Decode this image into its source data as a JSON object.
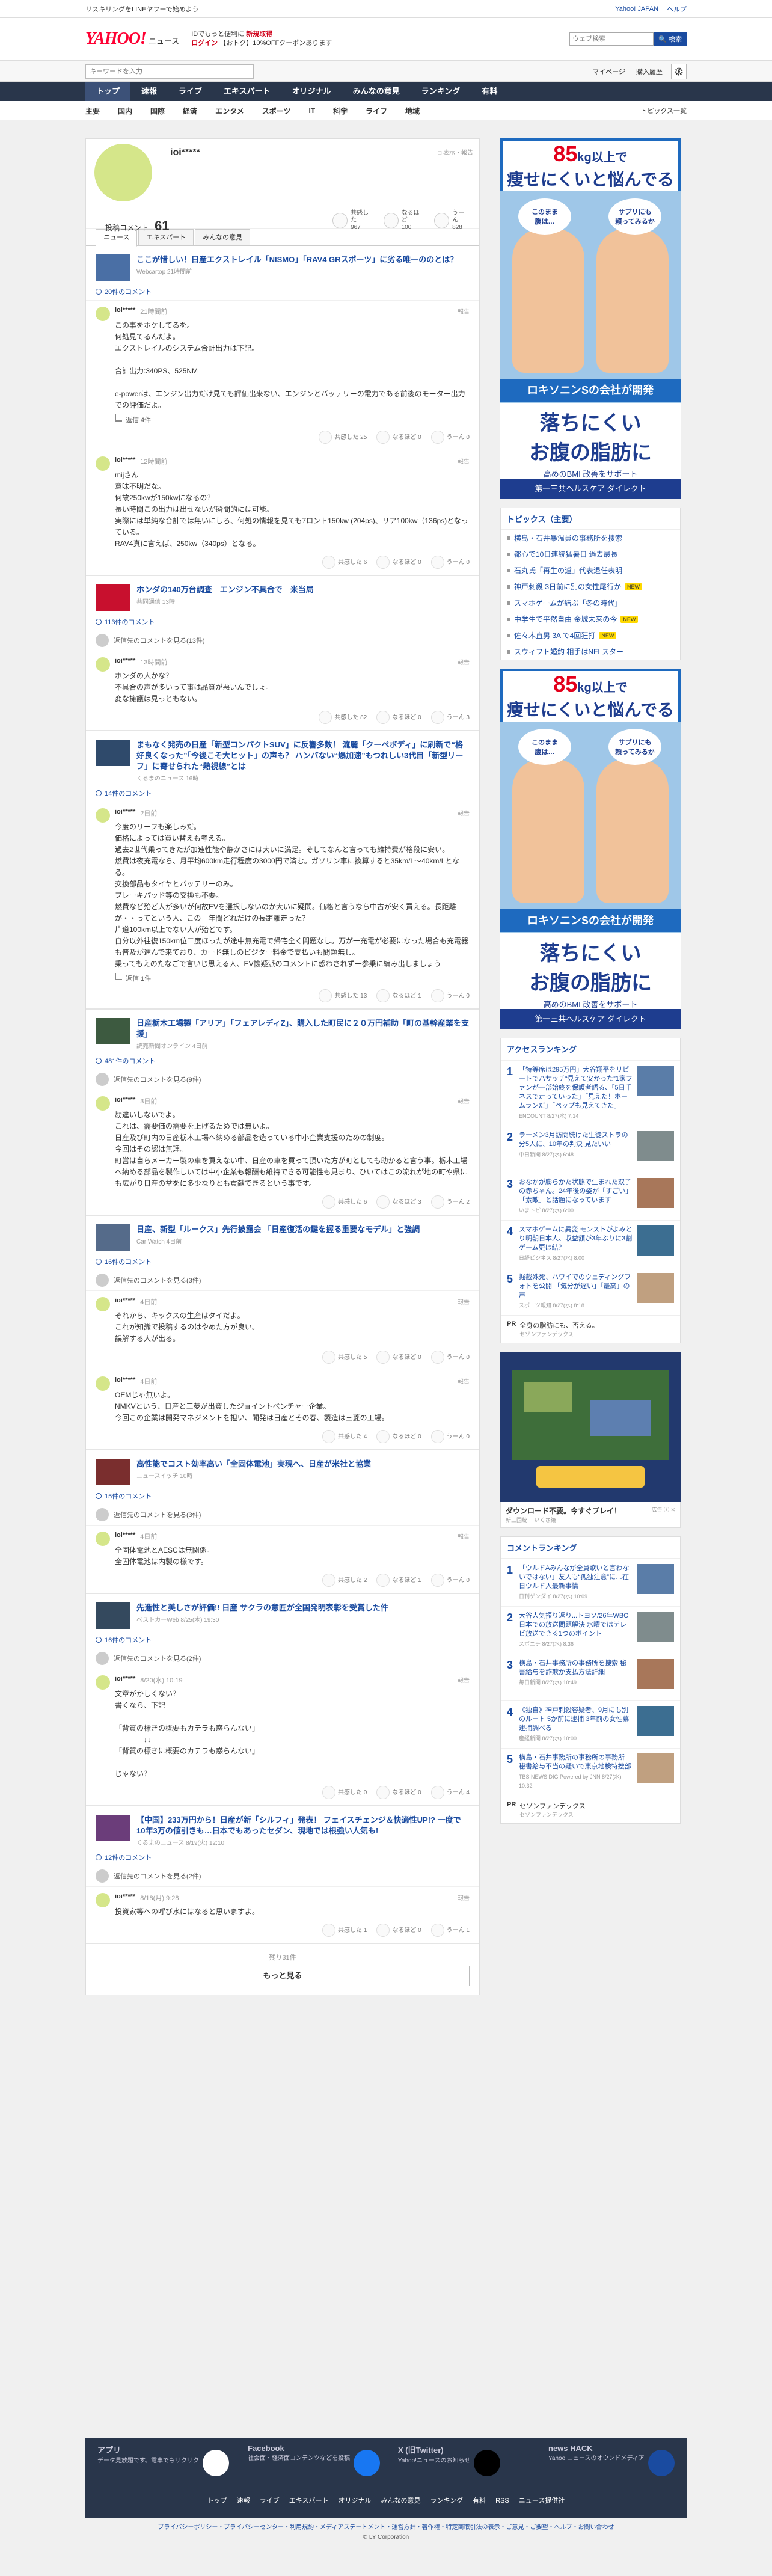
{
  "toplinks": {
    "left": "リスキリングをLINEヤフーで始めよう",
    "right": [
      "Yahoo! JAPAN",
      "ヘルプ"
    ]
  },
  "header": {
    "logo": "YAHOO!",
    "logo_sub": "ニュース",
    "promo_line1": "IDでもっと便利に",
    "promo_new": "新規取得",
    "promo_line2_a": "ログイン",
    "promo_line2_b": "【おトク】10%OFFクーポンあります",
    "search_placeholder": "ウェブ検索",
    "search_button": "🔍 検索"
  },
  "subbar": {
    "placeholder": "キーワードを入力",
    "mypage": "マイページ",
    "purchase": "購入履歴"
  },
  "nav": [
    "トップ",
    "速報",
    "ライブ",
    "エキスパート",
    "オリジナル",
    "みんなの意見",
    "ランキング",
    "有料"
  ],
  "cats": [
    "主要",
    "国内",
    "国際",
    "経済",
    "エンタメ",
    "スポーツ",
    "IT",
    "科学",
    "ライフ",
    "地域"
  ],
  "cat_list": "トピックス一覧",
  "profile": {
    "name": "ioi*****",
    "note": "□ 表示・報告",
    "count_label": "投稿コメント",
    "count": "61",
    "stats": [
      {
        "l1": "共感した",
        "l2": "967"
      },
      {
        "l1": "なるほど",
        "l2": "100"
      },
      {
        "l1": "うーん",
        "l2": "828"
      }
    ]
  },
  "tabs": [
    "ニュース",
    "エキスパート",
    "みんなの意見"
  ],
  "sections": [
    {
      "title": "ここが惜しい！日産エクストレイル「NISMO」「RAV4 GRスポーツ」に劣る唯一ののとは？",
      "src": "Webcartop 21時間前",
      "more": "20件のコメント",
      "comments": [
        {
          "name": "ioi*****",
          "time": "21時間前",
          "body": "この事をホケしてるを。\n何処見てるんだよ。\nエクストレイルのシステム合計出力は下記。\n\n合計出力:340PS、525NM\n\ne-powerは、エンジン出力だけ見ても評価出来ない、エンジンとバッテリーの電力である前後のモーター出力での評価だよ。",
          "reply": "返信 4件",
          "r": [
            "共感した 25",
            "なるほど 0",
            "うーん 0"
          ]
        },
        {
          "name": "ioi*****",
          "time": "12時間前",
          "body": "mijさん\n意味不明だな。\n何故250kwが150kwになるの？\n長い時間この出力は出せないが瞬間的には可能。\n実際には単純な合計では無いにしろ、何処の情報を見ても7ロント150kw (204ps)、リア100kw（136ps)となっている。\nRAV4真に言えば、250kw（340ps）となる。",
          "reply": "",
          "r": [
            "共感した 6",
            "なるほど 0",
            "うーん 0"
          ]
        }
      ]
    },
    {
      "title": "ホンダの140万台調査　エンジン不具合で　米当局",
      "src": "共同通信 13時",
      "more": "113件のコメント",
      "collapsed": "返信先のコメントを見る(13件)",
      "comments": [
        {
          "name": "ioi*****",
          "time": "13時間前",
          "body": "ホンダの人かな？\n不具合の声が多いって事は品質が悪いんでしょ。\n変な擁護は見っともない。",
          "reply": "",
          "r": [
            "共感した 82",
            "なるほど 0",
            "うーん 3"
          ]
        }
      ]
    },
    {
      "title": "まもなく発売の日産「新型コンパクトSUV」に反響多数！ 流麗「クーペボディ」に刷新で“格好良くなった”「今後こそ大ヒット」の声も？ ハンパない“爆加速”もつれしい3代目「新型リーフ」に寄せられた“熱視線”とは",
      "src": "くるまのニュース 16時",
      "more": "14件のコメント",
      "comments": [
        {
          "name": "ioi*****",
          "time": "2日前",
          "body": "今度のリーフも楽しみだ。\n価格によっては買い替えも考える。\n過去2世代乗ってきたが加速性能や静かさには大いに満足。そしてなんと言っても維持費が格段に安い。\n燃費は夜充電なら、月平均600km走行程度の3000円で済む。ガソリン車に換算すると35km/L〜40km/Lとなる。\n交換部品もタイヤとバッテリーのみ。\nブレーキパッド等の交換も不要。\n燃費など殆ど人が多いが何故EVを選択しないのか大いに疑問。価格と言うなら中古が安く買える。長距離が・・ってという人、この一年間どれだけの長距離走った？\n片道100km以上でない人が殆どです。\n自分以外往復150km位二度ほったが途中無充電で帰宅全く問題なし。万が一充電が必要になった場合も充電器も普及が進んで来ており、カード無しのビジター料金で支払いも問題無し。\n乗ってもえのたなごで言いじ思える人、EV懐疑派のコメントに惑わされず一参乗に編み出しましょう",
          "reply": "返信 1件",
          "r": [
            "共感した 13",
            "なるほど 1",
            "うーん 0"
          ]
        }
      ]
    },
    {
      "title": "日産栃木工場製「アリア」「フェアレディZ」、購入した町民に２０万円補助「町の基幹産業を支援」",
      "src": "読売新聞オンライン 4日前",
      "more": "481件のコメント",
      "collapsed": "返信先のコメントを見る(9件)",
      "comments": [
        {
          "name": "ioi*****",
          "time": "3日前",
          "body": "勘違いしないでよ。\nこれは、需要価の需要を上げるためでは無いよ。\n日産及び町内の日産栃木工場へ納める部品を造っている中小企業支援のための制度。\n今回はその認は無理。\n町営は自らメーカー製の車を買えない中、日産の車を買って頂いた方が町としても助かると言う事。栃木工場へ納める部品を製作しいては中小企業も報酬も維持できる可能性も見まり、ひいてはこの流れが地の町や県にも広がり日産の益をに多少なりとも貢献できるという事です。",
          "reply": "",
          "r": [
            "共感した 6",
            "なるほど 3",
            "うーん 2"
          ]
        }
      ]
    },
    {
      "title": "日産、新型「ルークス」先行披露会 「日産復活の鍵を握る重要なモデル」と強調",
      "src": "Car Watch 4日前",
      "more": "16件のコメント",
      "collapsed": "返信先のコメントを見る(3件)",
      "comments": [
        {
          "name": "ioi*****",
          "time": "4日前",
          "body": "それから、キックスの生産はタイだよ。\nこれが知識で投稿するのはやめた方が良い。\n誤解する人が出る。",
          "reply": "",
          "r": [
            "共感した 5",
            "なるほど 0",
            "うーん 0"
          ]
        },
        {
          "name": "ioi*****",
          "time": "4日前",
          "body": "OEMじゃ無いよ。\nNMKVという、日産と三菱が出資したジョイントベンチャー企業。\n今回この企業は開発マネジメントを担い、開発は日産とその春、製造は三菱の工場。",
          "reply": "",
          "r": [
            "共感した 4",
            "なるほど 0",
            "うーん 0"
          ]
        }
      ]
    },
    {
      "title": "高性能でコスト効率高い「全固体電池」実現へ、日産が米社と協業",
      "src": "ニュースイッチ 10時",
      "more": "15件のコメント",
      "collapsed": "返信先のコメントを見る(3件)",
      "comments": [
        {
          "name": "ioi*****",
          "time": "4日前",
          "body": "全固体電池とAESCは無関係。\n全固体電池は内製の様です。",
          "reply": "",
          "r": [
            "共感した 2",
            "なるほど 1",
            "うーん 0"
          ]
        }
      ]
    },
    {
      "title": "先進性と美しさが評価!! 日産 サクラの意匠が全国発明表彰を受賞した件",
      "src": "ベストカーWeb 8/25(木) 19:30",
      "more": "16件のコメント",
      "collapsed": "返信先のコメントを見る(2件)",
      "comments": [
        {
          "name": "ioi*****",
          "time": "8/20(水) 10:19",
          "body": "文章がかしくない？\n書くなら、下記\n\n「背質の標きの概要もカテラも惑らんない」\n　　　　↓↓\n「背質の標きに概要のカテラも惑らんない」\n\nじゃない？",
          "reply": "",
          "r": [
            "共感した 0",
            "なるほど 0",
            "うーん 4"
          ]
        }
      ]
    },
    {
      "title": "【中国】233万円から！日産が新「シルフィ」発表！ フェイスチェンジ＆快適性UP!? 一度で10年3万の値引きも…日本でもあったセダン、現地では根強い人気も!",
      "src": "くるまのニュース 8/19(火) 12:10",
      "more": "12件のコメント",
      "collapsed": "返信先のコメントを見る(2件)",
      "comments": [
        {
          "name": "ioi*****",
          "time": "8/18(月) 9:28",
          "body": "投資家等への呼び水にはなると思いますよ。",
          "reply": "",
          "r": [
            "共感した 1",
            "なるほど 0",
            "うーん 1"
          ]
        }
      ]
    }
  ],
  "list_footer": {
    "count": "残り31件",
    "load_more": "もっと見る"
  },
  "ad": {
    "label": "広告 ⓘ ✕",
    "weight": "85",
    "weight_unit": "kg以上で",
    "line1": "痩せにくいと悩んでる",
    "bubble1": "このまま\n腹は…",
    "bubble2": "サプリにも\n頼ってみるか",
    "band": "ロキソニンSの会社が開発",
    "big1": "落ちにくい",
    "big2": "お腹の脂肪に",
    "sub": "高めのBMI 改善をサポート",
    "foot": "第一三共ヘルスケア ダイレクト"
  },
  "topics": {
    "title": "トピックス（主要）",
    "items": [
      {
        "t": "横島・石井暴温員の事務所を捜索",
        "b": ""
      },
      {
        "t": "都心で10日連続猛暑日 過去最長",
        "b": ""
      },
      {
        "t": "石丸氏「再生の道」代表退任表明",
        "b": ""
      },
      {
        "t": "神戸刺殺 3日前に別の女性尾行か",
        "b": "NEW"
      },
      {
        "t": "スマホゲームが結ぶ「冬の時代」",
        "b": ""
      },
      {
        "t": "中学生で平然自由 金城未来の今",
        "b": "NEW"
      },
      {
        "t": "佐々木直男 3A で4回狂打",
        "b": "NEW"
      },
      {
        "t": "スウィフト婚約 相手はNFLスター",
        "b": ""
      }
    ]
  },
  "access": {
    "title": "アクセスランキング",
    "items": [
      {
        "t": "「特等席は295万円」大谷翔平をリピートでハサッチ“見えて安かった”1家ファンが一部始終を保護者語る、「5日千ネスで走っていった」「見えた！ホームランだ」「ペップも見えてきた」",
        "s": "ENCOUNT 8/27(水) 7:14"
      },
      {
        "t": "ラーメン3月訪問続けた生徒ストラの分5人に、10年の判決 見たいい",
        "s": "中日新聞 8/27(水) 6:48"
      },
      {
        "t": "おなかが膨らかた状態で生まれた双子の赤ちゃん。24年後の姿が「すごい」「素敵」と話題になっています",
        "s": "いまトピ 8/27(水) 6:00"
      },
      {
        "t": "スマホゲームに異変 モンストがよみとり明朝日本人、収益額が3年ぶりに3割ゲーム更は結？",
        "s": "日経ビジネス 8/27(水) 8:00"
      },
      {
        "t": "掘截殊死、ハワイでのウェディングフォトを公開 「気分が遅い」「最高」の声",
        "s": "スポーツ報知 8/27(水) 8:18"
      }
    ]
  },
  "pr1": {
    "label": "PR",
    "t": "全身の脂肪にも、否える。",
    "s": "セゾンファンデックス"
  },
  "game": {
    "title": "ダウンロード不要。今すぐプレイ！",
    "sub": "新三国統一 いくさ絵",
    "label": "広告 ⓘ ✕"
  },
  "comment_rank": {
    "title": "コメントランキング",
    "items": [
      {
        "t": "「ウルドAみんなが全員歌いと言わないではない」友人も“孤独注意”に…在日ウルド人最新事情",
        "s": "日刊ゲンダイ 8/27(水) 10:09"
      },
      {
        "t": "大谷人気振り返り...トヨソ/26年WBC日本での放送問題解決 水曜ではテレビ放送できる1つのポイント",
        "s": "スポニチ 8/27(水) 8:36"
      },
      {
        "t": "横島・石井事務所の事務所を捜索 秘書給与を詐欺か支払方法詳細",
        "s": "毎日新聞 8/27(水) 10:49"
      },
      {
        "t": "《独自》神戸刺殺容疑者、9月にも別のルート 5か前に逮捕 3年前の女性慕逮捕調べる",
        "s": "産経新聞 8/27(水) 10:00"
      },
      {
        "t": "横島・石井事務所の事務所の事務所 秘書給与不当の疑いで東京地検特捜部",
        "s": "TBS NEWS DIG Powered by JNN 8/27(水) 10:32"
      }
    ]
  },
  "pr2": {
    "label": "PR",
    "t": "セゾンファンデックス",
    "s": "セゾンファンデックス"
  },
  "footer": {
    "cols": [
      {
        "t": "アプリ",
        "s": "データ見放題です。電車でもサクサク"
      },
      {
        "t": "Facebook",
        "s": "社会面・経済面コンテンツなどを投稿"
      },
      {
        "t": "X (旧Twitter)",
        "s": "Yahoo!ニュースのお知らせ"
      },
      {
        "t": "news HACK",
        "s": "Yahoo!ニュースのオウンドメディア"
      }
    ],
    "links": [
      "トップ",
      "速報",
      "ライブ",
      "エキスパート",
      "オリジナル",
      "みんなの意見",
      "ランキング",
      "有料",
      "RSS",
      "ニュース提供社"
    ]
  },
  "legal": {
    "line1": "プライバシーポリシー・プライバシーセンター・利用規約・メディアステートメント・運営方針・著作権・特定商取引法の表示・ご意見・ご要望・ヘルプ・お問い合わせ",
    "copy": "© LY Corporation"
  }
}
